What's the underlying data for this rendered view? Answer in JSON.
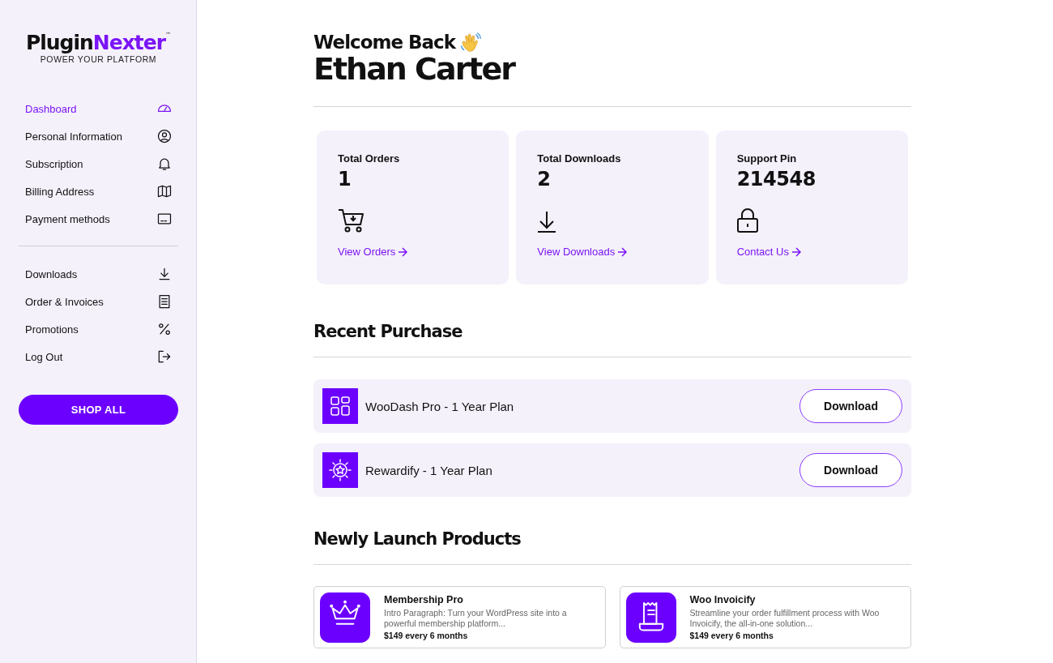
{
  "logo": {
    "name_start": "Plugin",
    "name_end": "Nexter",
    "trademark": "™",
    "tagline": "POWER YOUR PLATFORM"
  },
  "sidebar": {
    "groups": [
      {
        "items": [
          {
            "label": "Dashboard",
            "selected": true
          },
          {
            "label": "Personal Information",
            "selected": false
          },
          {
            "label": "Subscription",
            "selected": false
          },
          {
            "label": "Billing Address",
            "selected": false
          },
          {
            "label": "Payment methods",
            "selected": false
          }
        ]
      },
      {
        "items": [
          {
            "label": "Downloads",
            "selected": false
          },
          {
            "label": "Order & Invoices",
            "selected": false
          },
          {
            "label": "Promotions",
            "selected": false
          },
          {
            "label": "Log Out",
            "selected": false
          }
        ]
      }
    ],
    "button": "SHOP ALL"
  },
  "greeting": {
    "title": "Welcome Back",
    "name": "Ethan Carter"
  },
  "stats": [
    {
      "label": "Total Orders",
      "value": "1",
      "link": "View Orders"
    },
    {
      "label": "Total Downloads",
      "value": "2",
      "link": "View Downloads"
    },
    {
      "label": "Support Pin",
      "value": "214548",
      "link": "Contact Us"
    }
  ],
  "recent_purchase": {
    "title": "Recent Purchase",
    "items": [
      {
        "name": "WooDash Pro - 1 Year Plan",
        "button": "Download"
      },
      {
        "name": "Rewardify - 1 Year Plan",
        "button": "Download"
      }
    ]
  },
  "new_products": {
    "title": "Newly Launch Products",
    "items": [
      {
        "name": "Membership Pro",
        "description": "Intro Paragraph: Turn your WordPress site into a powerful membership platform...",
        "price": "$149 every 6 months"
      },
      {
        "name": "Woo Invoicify",
        "description": "Streamline your order fulfillment process with Woo Invoicify, the all-in-one solution...",
        "price": "$149 every 6 months"
      }
    ]
  }
}
